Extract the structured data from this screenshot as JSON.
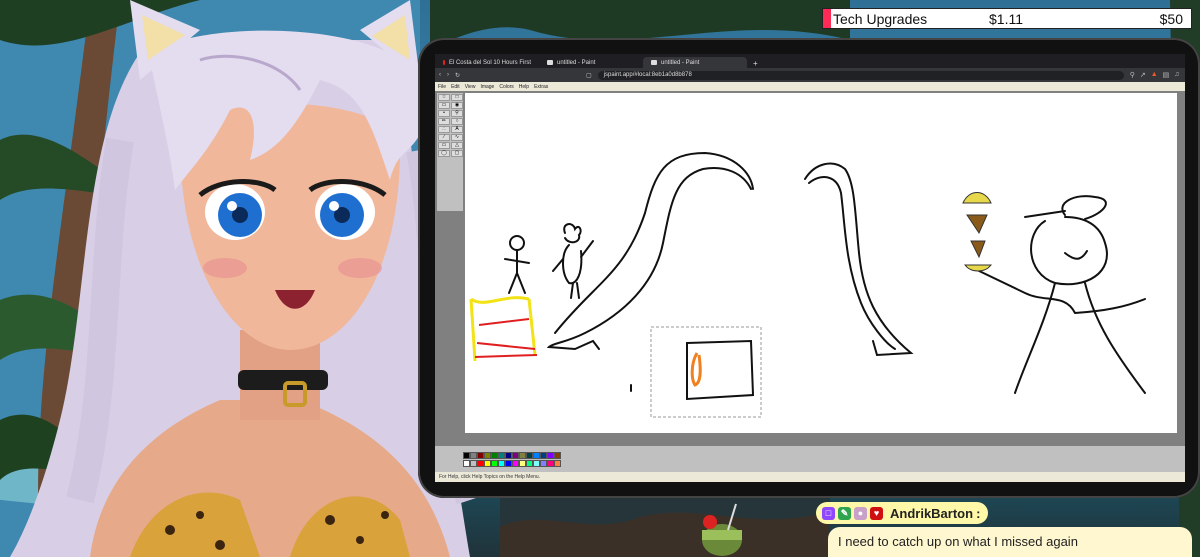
{
  "stream_goal": {
    "label": "Tech Upgrades",
    "current": "$1.11",
    "target": "$50",
    "progress": 0.022,
    "color": "#ff2a55"
  },
  "browser": {
    "tabs": [
      {
        "title": "El Costa del Sol 10 Hours First",
        "icon": "youtube-icon",
        "active": false
      },
      {
        "title": "untitled - Paint",
        "icon": "paint-icon",
        "active": false
      },
      {
        "title": "untitled - Paint",
        "icon": "paint-icon",
        "active": true
      }
    ],
    "new_tab": "+",
    "url": "jspaint.app/#local:8eb1a0d8b878"
  },
  "paint": {
    "menu": [
      "File",
      "Edit",
      "View",
      "Image",
      "Colors",
      "Help",
      "Extras"
    ],
    "status": "For Help, click Help Topics on the Help Menu.",
    "palette": [
      "#000000",
      "#808080",
      "#800000",
      "#808000",
      "#008000",
      "#008080",
      "#000080",
      "#800080",
      "#808040",
      "#004040",
      "#0080ff",
      "#004080",
      "#8000ff",
      "#804000",
      "#ffffff",
      "#c0c0c0",
      "#ff0000",
      "#ffff00",
      "#00ff00",
      "#00ffff",
      "#0000ff",
      "#ff00ff",
      "#ffff80",
      "#00ff80",
      "#80ffff",
      "#8080ff",
      "#ff0080",
      "#ff8040"
    ]
  },
  "chat": {
    "username": "AndrikBarton",
    "username_suffix": ":",
    "badges": [
      "twitch-icon",
      "pencil-icon",
      "controller-icon",
      "heart-icon"
    ],
    "message": "I need to catch up on what I missed again"
  }
}
